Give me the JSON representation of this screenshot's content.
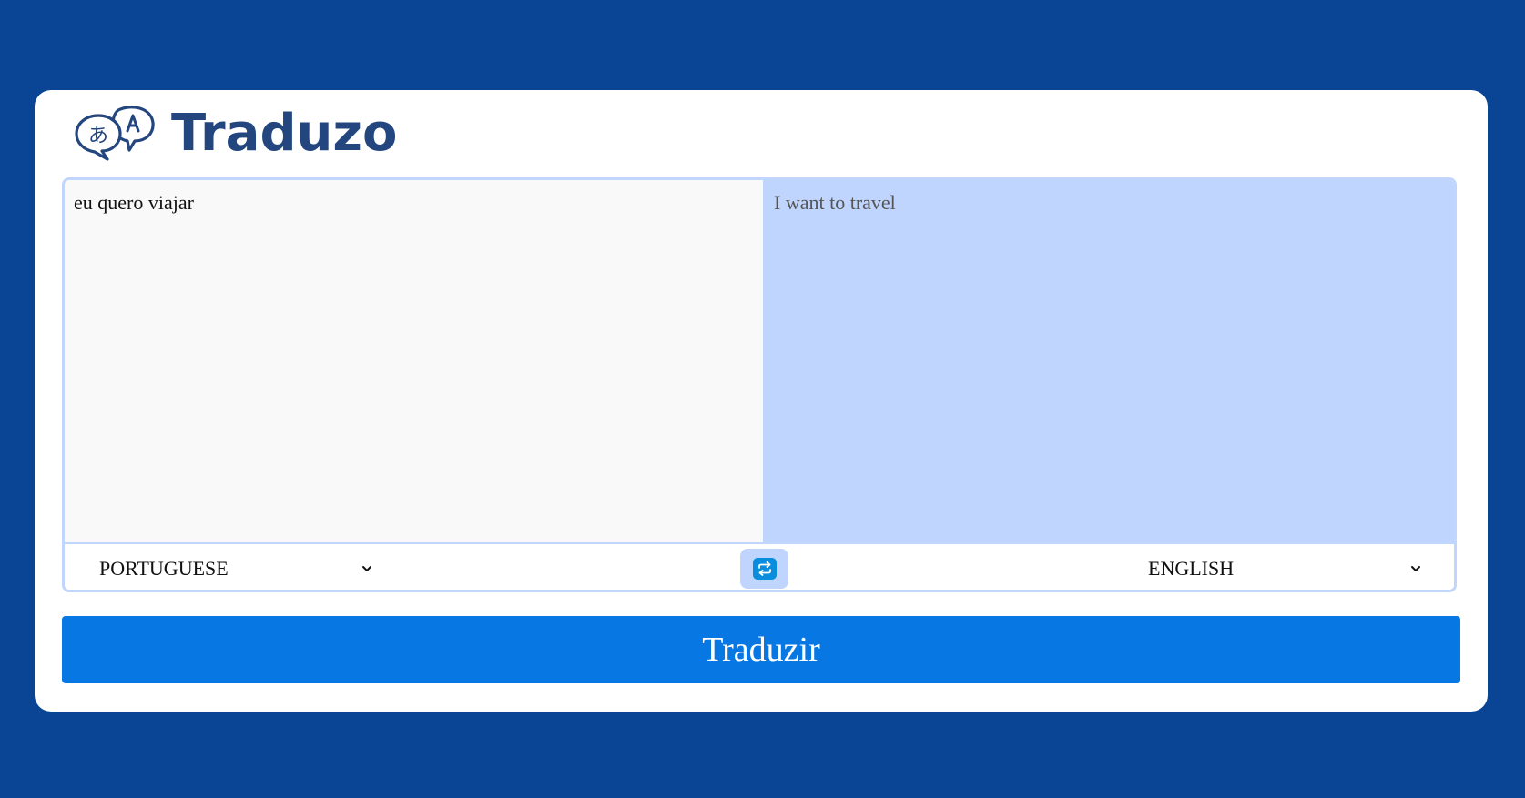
{
  "app": {
    "name": "Traduzo"
  },
  "source": {
    "text": "eu quero viajar",
    "language": "PORTUGUESE"
  },
  "target": {
    "text": "I want to travel",
    "language": "ENGLISH"
  },
  "actions": {
    "translate_label": "Traduzir",
    "swap_icon": "swap-arrows-icon"
  },
  "colors": {
    "page_background": "#094594",
    "brand": "#23467f",
    "output_background": "#c0d5fd",
    "button": "#0677e3",
    "swap_icon": "#0b8ddd"
  }
}
